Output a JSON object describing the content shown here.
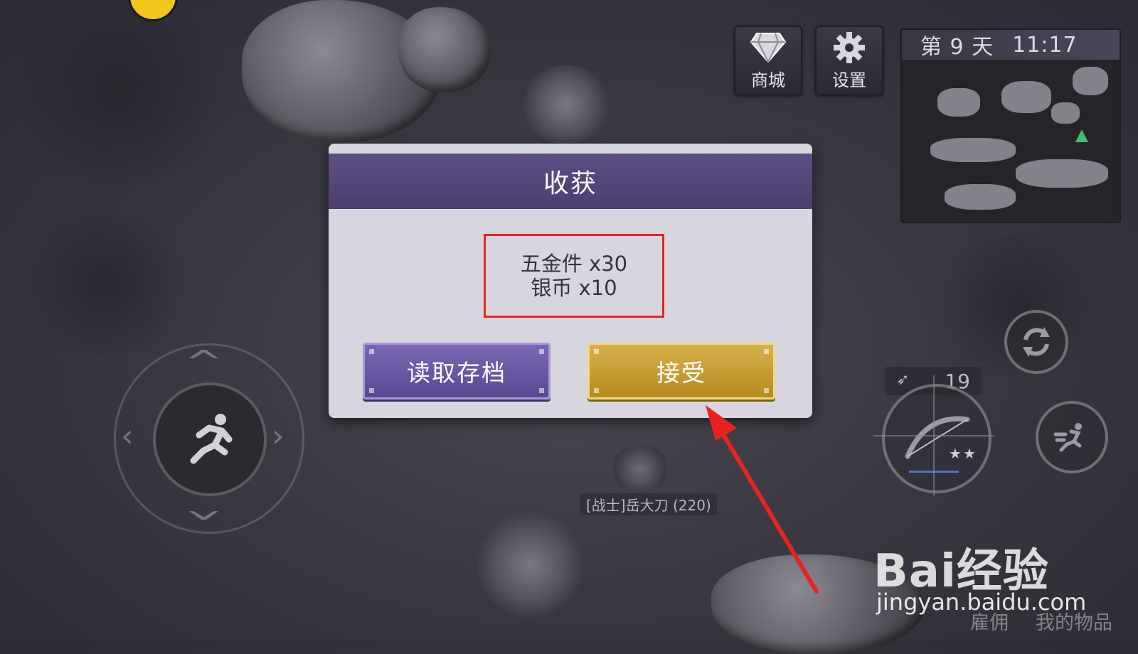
{
  "top_buttons": {
    "shop_label": "商城",
    "shop_icon": "diamond-icon",
    "settings_label": "设置",
    "settings_icon": "gear-icon"
  },
  "minimap": {
    "day_text": "第 9 天",
    "time_text": "11:17"
  },
  "dialog": {
    "title": "收获",
    "rewards": [
      "五金件 x30",
      "银币 x10"
    ],
    "load_save_label": "读取存档",
    "accept_label": "接受"
  },
  "player": {
    "name_tag": "[战士]岳大刀 (220)"
  },
  "weapon": {
    "ammo_count": "19",
    "icon": "bow-icon",
    "stars": 2
  },
  "bottom_tabs": {
    "hire_label": "雇佣",
    "items_label": "我的物品"
  },
  "watermark": {
    "logo_text": "Bai经验",
    "url": "jingyan.baidu.com"
  },
  "colors": {
    "dialog_header": "#5d4e85",
    "accept_gold": "#c9a03a",
    "load_purple": "#6a58a3",
    "highlight_red": "#e8231f"
  }
}
